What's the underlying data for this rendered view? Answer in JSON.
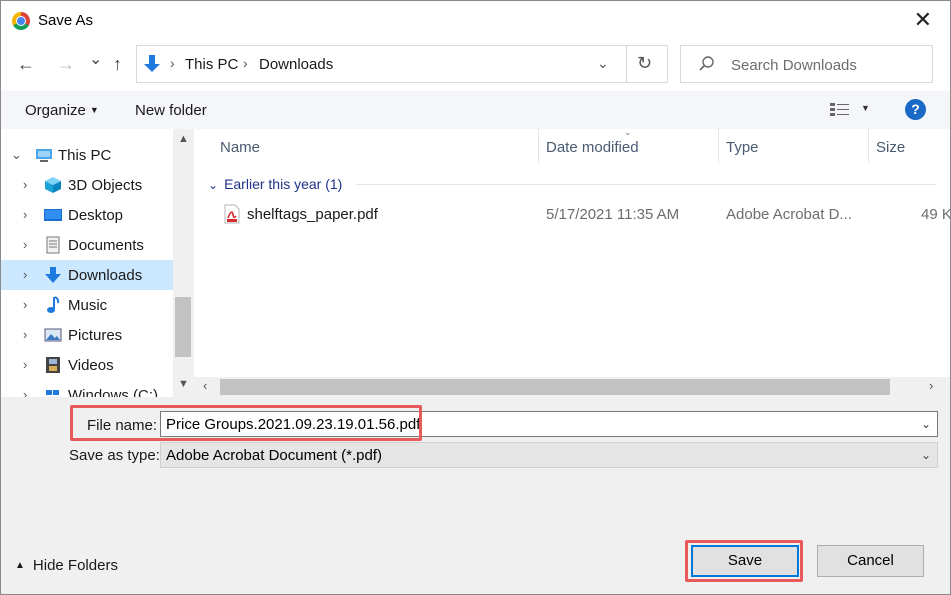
{
  "window": {
    "title": "Save As",
    "close_glyph": "✕"
  },
  "nav": {
    "back_glyph": "←",
    "forward_glyph": "→",
    "recent_glyph": "⌄",
    "up_glyph": "↑",
    "breadcrumb": [
      "This PC",
      "Downloads"
    ],
    "refresh_glyph": "↻",
    "search_placeholder": "Search Downloads"
  },
  "toolbar": {
    "organize_label": "Organize",
    "new_folder_label": "New folder",
    "help_label": "?"
  },
  "nav_pane": {
    "items": [
      {
        "label": "This PC",
        "icon": "computer-icon",
        "expanded": true
      },
      {
        "label": "3D Objects",
        "icon": "cube-icon"
      },
      {
        "label": "Desktop",
        "icon": "desktop-icon"
      },
      {
        "label": "Documents",
        "icon": "document-icon"
      },
      {
        "label": "Downloads",
        "icon": "download-icon",
        "selected": true
      },
      {
        "label": "Music",
        "icon": "music-note-icon"
      },
      {
        "label": "Pictures",
        "icon": "picture-icon"
      },
      {
        "label": "Videos",
        "icon": "film-icon"
      },
      {
        "label": "Windows (C:)",
        "icon": "drive-icon"
      }
    ]
  },
  "file_list": {
    "columns": [
      "Name",
      "Date modified",
      "Type",
      "Size"
    ],
    "group_label": "Earlier this year (1)",
    "files": [
      {
        "name": "shelftags_paper.pdf",
        "date_modified": "5/17/2021 11:35 AM",
        "type": "Adobe Acrobat D...",
        "size": "49 K"
      }
    ]
  },
  "form": {
    "file_name_label": "File name:",
    "file_name_value": "Price Groups.2021.09.23.19.01.56.pdf",
    "save_as_type_label": "Save as type:",
    "save_as_type_value": "Adobe Acrobat Document (*.pdf)"
  },
  "footer": {
    "hide_folders_label": "Hide Folders",
    "save_label": "Save",
    "cancel_label": "Cancel"
  },
  "colors": {
    "highlight_border": "#e8595c",
    "selection": "#cce8ff",
    "accent": "#0078d7"
  }
}
